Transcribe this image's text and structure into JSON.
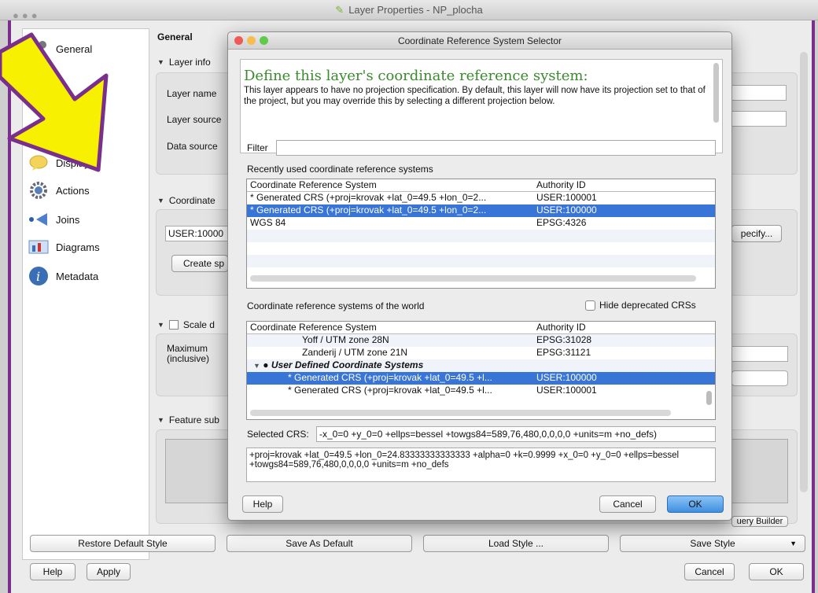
{
  "window": {
    "title": "Layer Properties - NP_plocha"
  },
  "sidebar": {
    "items": [
      {
        "label": "General",
        "icon": "wrench-icon"
      },
      {
        "label": "e",
        "icon": "style-icon"
      },
      {
        "label": "s",
        "icon": "labels-icon"
      },
      {
        "label": "Display",
        "icon": "speech-bubble-icon"
      },
      {
        "label": "Actions",
        "icon": "gear-icon"
      },
      {
        "label": "Joins",
        "icon": "join-arrow-icon"
      },
      {
        "label": "Diagrams",
        "icon": "diagram-icon"
      },
      {
        "label": "Metadata",
        "icon": "info-icon"
      }
    ]
  },
  "general": {
    "heading": "General",
    "layer_info": "Layer info",
    "layer_name": "Layer name",
    "layer_source": "Layer source",
    "data_source": "Data source",
    "coordinate": "Coordinate",
    "crs_value": "USER:10000",
    "create_btn": "Create sp",
    "specify_btn": "pecify...",
    "scale_label": "Scale d",
    "maximum": "Maximum",
    "inclusive": "(inclusive)",
    "feature_sub": "Feature sub",
    "query_builder": "uery Builder"
  },
  "footer": {
    "restore": "Restore Default Style",
    "save_default": "Save As Default",
    "load_style": "Load Style ...",
    "save_style": "Save Style",
    "help": "Help",
    "apply": "Apply",
    "cancel": "Cancel",
    "ok": "OK"
  },
  "dialog": {
    "title": "Coordinate Reference System Selector",
    "heading": "Define this layer's coordinate reference system:",
    "text": "This layer appears to have no projection specification. By default, this layer will now have its projection set to that of the project, but you may override this by selecting a different projection below.",
    "filter_label": "Filter",
    "filter_value": "",
    "recent_label": "Recently used coordinate reference systems",
    "col_crs": "Coordinate Reference System",
    "col_auth": "Authority ID",
    "recent_rows": [
      {
        "crs": "* Generated CRS (+proj=krovak +lat_0=49.5 +lon_0=2...",
        "auth": "USER:100001"
      },
      {
        "crs": "* Generated CRS (+proj=krovak +lat_0=49.5 +lon_0=2...",
        "auth": "USER:100000"
      },
      {
        "crs": "WGS 84",
        "auth": "EPSG:4326"
      }
    ],
    "world_label": "Coordinate reference systems of the world",
    "hide_deprecated": "Hide deprecated CRSs",
    "world_rows": [
      {
        "crs": "Yoff / UTM zone 28N",
        "auth": "EPSG:31028"
      },
      {
        "crs": "Zanderij / UTM zone 21N",
        "auth": "EPSG:31121"
      },
      {
        "crs": "User Defined Coordinate Systems",
        "auth": ""
      },
      {
        "crs": "* Generated CRS (+proj=krovak +lat_0=49.5 +l...",
        "auth": "USER:100000"
      },
      {
        "crs": "* Generated CRS (+proj=krovak +lat_0=49.5 +l...",
        "auth": "USER:100001"
      }
    ],
    "selected_label": "Selected CRS:",
    "selected_value": "-x_0=0 +y_0=0 +ellps=bessel +towgs84=589,76,480,0,0,0,0 +units=m +no_defs)",
    "proj_text": "+proj=krovak +lat_0=49.5 +lon_0=24.83333333333333 +alpha=0 +k=0.9999 +x_0=0 +y_0=0 +ellps=bessel +towgs84=589,76,480,0,0,0,0 +units=m +no_defs",
    "help": "Help",
    "cancel": "Cancel",
    "ok": "OK"
  },
  "colors": {
    "accent": "#3875d7",
    "heading_green": "#3a8a2e",
    "frame_purple": "#7a2f8c",
    "arrow_yellow": "#f7f000"
  }
}
